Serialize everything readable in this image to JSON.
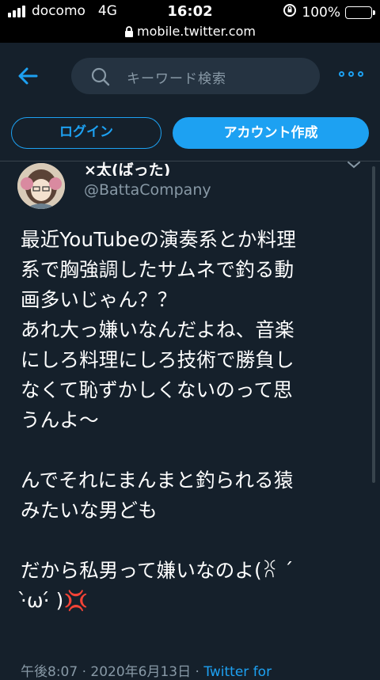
{
  "status_bar": {
    "carrier": "docomo",
    "network": "4G",
    "time": "16:02",
    "battery": "100%"
  },
  "browser": {
    "url": "mobile.twitter.com"
  },
  "header": {
    "search_placeholder": "キーワード検索",
    "back_icon": "arrow-left-icon",
    "more_icon": "more-icon"
  },
  "auth": {
    "login_label": "ログイン",
    "signup_label": "アカウント作成"
  },
  "tweet": {
    "display_name": "×太(ばった)",
    "handle": "@BattaCompany",
    "text": "最近YouTubeの演奏系とか料理\n系で胸強調したサムネで釣る動\n画多いじゃん？？\nあれ大っ嫌いなんだよね、音楽\nにしろ料理にしろ技術で勝負し\nなくて恥ずかしくないのって思\nうんよ〜\n\nんでそれにまんまと釣られる猿\nみたいな男ども\n\nだから私男って嫌いなのよ(ꐦ ´\n·̀ω·́ )💢",
    "timestamp": "午後8:07 · 2020年6月13日 · ",
    "source": "Twitter for"
  },
  "colors": {
    "background": "#15202b",
    "accent": "#1da1f2",
    "muted": "#8899a6"
  }
}
